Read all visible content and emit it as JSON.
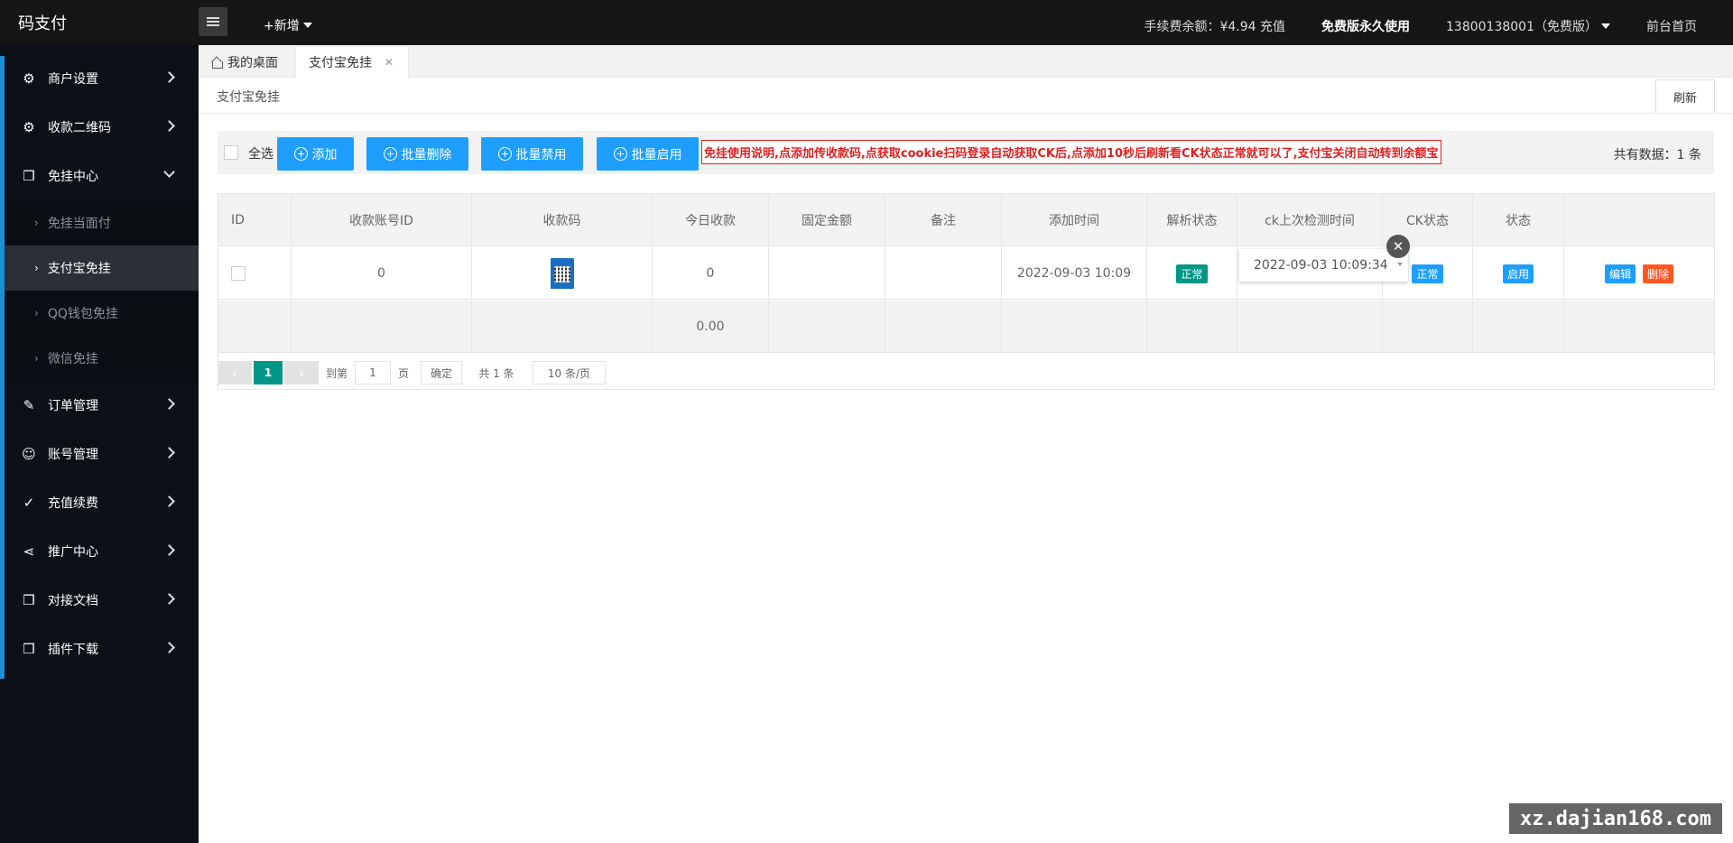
{
  "app": {
    "logo": "码支付"
  },
  "topbar": {
    "new_label": "+新增",
    "balance": "手续费余额：¥4.94 充值",
    "plan": "免费版永久使用",
    "account": "13800138001（免费版）",
    "home_link": "前台首页"
  },
  "sidebar": {
    "items": [
      {
        "label": "商户设置",
        "icon": "gear-icon"
      },
      {
        "label": "收款二维码",
        "icon": "gear-icon"
      },
      {
        "label": "免挂中心",
        "icon": "cube-icon"
      },
      {
        "label": "订单管理",
        "icon": "edit-icon"
      },
      {
        "label": "账号管理",
        "icon": "user-icon"
      },
      {
        "label": "充值续费",
        "icon": "leaf-icon"
      },
      {
        "label": "推广中心",
        "icon": "share-icon"
      },
      {
        "label": "对接文档",
        "icon": "cube-icon"
      },
      {
        "label": "插件下载",
        "icon": "cube-icon"
      }
    ],
    "sub_items": [
      {
        "label": "免挂当面付"
      },
      {
        "label": "支付宝免挂"
      },
      {
        "label": "QQ钱包免挂"
      },
      {
        "label": "微信免挂"
      }
    ]
  },
  "tabs": [
    {
      "label": "我的桌面"
    },
    {
      "label": "支付宝免挂"
    }
  ],
  "breadcrumb": "支付宝免挂",
  "refresh_label": "刷新",
  "toolbar": {
    "select_all": "全选",
    "add": "添加",
    "batch_delete": "批量删除",
    "batch_disable": "批量禁用",
    "batch_enable": "批量启用",
    "notice": "免挂使用说明,点添加传收款码,点获取cookie扫码登录自动获取CK后,点添加10秒后刷新看CK状态正常就可以了,支付宝关闭自动转到余额宝",
    "count": "共有数据：1 条"
  },
  "table": {
    "headers": [
      "ID",
      "收款账号ID",
      "收款码",
      "今日收款",
      "固定金额",
      "备注",
      "添加时间",
      "解析状态",
      "ck上次检测时间",
      "CK状态",
      "状态",
      ""
    ],
    "row": {
      "account_id": "0",
      "today": "0",
      "fixed": "",
      "remark": "",
      "added": "2022-09-03 10:09",
      "parse_status": "正常",
      "ck_time": "2022-09-03 10:09:34",
      "ck_status": "正常",
      "status": "启用",
      "edit": "编辑",
      "delete": "删除"
    },
    "total_today": "0.00"
  },
  "pager": {
    "current": "1",
    "goto": "到第",
    "page_input": "1",
    "page_unit": "页",
    "confirm": "确定",
    "total": "共 1 条",
    "per_page": "10 条/页"
  },
  "watermark": "xz.dajian168.com",
  "colors": {
    "accent": "#1e9fff",
    "green": "#009688",
    "orange": "#ff5722",
    "notice": "#e02020"
  }
}
